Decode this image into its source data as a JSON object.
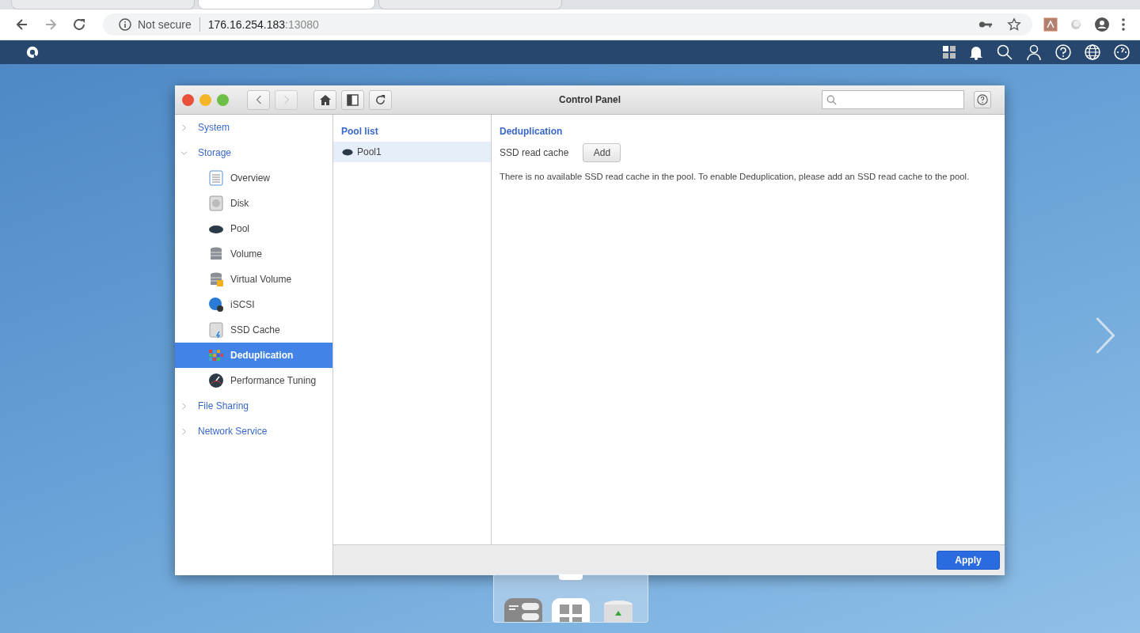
{
  "browser": {
    "tabs": [
      {
        "selected": false
      },
      {
        "selected": true
      },
      {
        "selected": false
      }
    ],
    "security": "Not secure",
    "url_host": "176.16.254.183",
    "url_port": ":13080"
  },
  "window": {
    "title": "Control Panel"
  },
  "sidebar": {
    "items": [
      {
        "label": "System",
        "expanded": false,
        "selected": false
      },
      {
        "label": "Storage",
        "expanded": true,
        "selected": false,
        "children": [
          {
            "label": "Overview",
            "selected": false
          },
          {
            "label": "Disk",
            "selected": false
          },
          {
            "label": "Pool",
            "selected": false
          },
          {
            "label": "Volume",
            "selected": false
          },
          {
            "label": "Virtual Volume",
            "selected": false
          },
          {
            "label": "iSCSI",
            "selected": false
          },
          {
            "label": "SSD Cache",
            "selected": false
          },
          {
            "label": "Deduplication",
            "selected": true
          },
          {
            "label": "Performance Tuning",
            "selected": false
          }
        ]
      },
      {
        "label": "File Sharing",
        "expanded": false,
        "selected": false
      },
      {
        "label": "Network Service",
        "expanded": false,
        "selected": false
      }
    ]
  },
  "pool_list": {
    "title": "Pool list",
    "items": [
      {
        "label": "Pool1",
        "selected": true
      }
    ]
  },
  "content": {
    "title": "Deduplication",
    "field_label": "SSD read cache",
    "add_button": "Add",
    "message": "There is no available SSD read cache in the pool. To enable Deduplication, please add an SSD read cache to the pool."
  },
  "footer": {
    "apply_button": "Apply"
  }
}
